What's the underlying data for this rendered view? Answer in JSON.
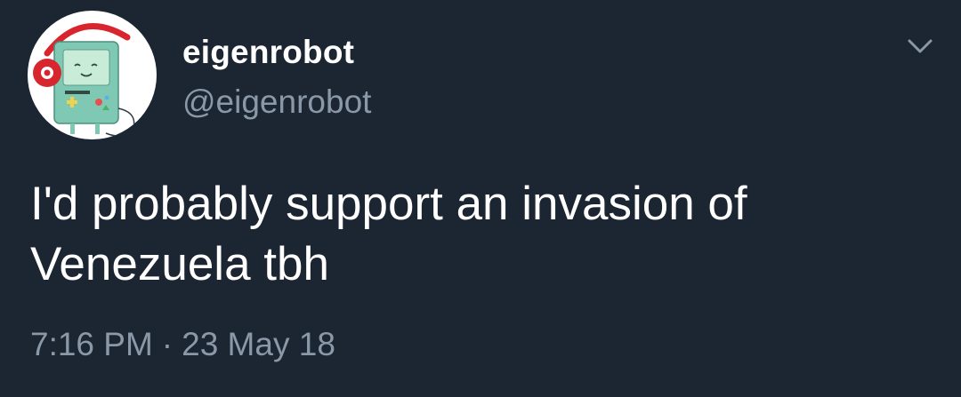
{
  "author": {
    "display_name": "eigenrobot",
    "handle": "@eigenrobot",
    "avatar_icon": "bmo-with-headphones-avatar"
  },
  "tweet": {
    "text_line_1": "I'd probably support an invasion of",
    "text_line_2": "Venezuela tbh",
    "time": "7:16 PM",
    "separator": "·",
    "date": "23 May 18"
  },
  "controls": {
    "menu_icon": "chevron-down-icon"
  },
  "colors": {
    "background": "#1c2532",
    "primary_text": "#ffffff",
    "secondary_text": "#8a98a8",
    "headphones_red": "#d8262e",
    "bmo_teal": "#7fc9b4"
  }
}
